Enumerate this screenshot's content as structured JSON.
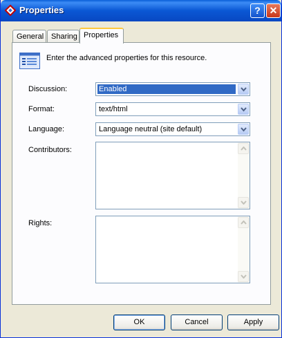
{
  "window": {
    "title": "Properties"
  },
  "title_buttons": {
    "help": "?",
    "close": "✕"
  },
  "tabs": [
    {
      "label": "General"
    },
    {
      "label": "Sharing"
    },
    {
      "label": "Properties"
    }
  ],
  "panel": {
    "header_text": "Enter the advanced properties for this resource.",
    "fields": {
      "discussion": {
        "label": "Discussion:",
        "value": "Enabled"
      },
      "format": {
        "label": "Format:",
        "value": "text/html"
      },
      "language": {
        "label": "Language:",
        "value": "Language neutral (site default)"
      },
      "contributors": {
        "label": "Contributors:",
        "value": ""
      },
      "rights": {
        "label": "Rights:",
        "value": ""
      }
    }
  },
  "buttons": {
    "ok": "OK",
    "cancel": "Cancel",
    "apply": "Apply"
  },
  "colors": {
    "titlebar": "#0a57d4",
    "selection": "#316ac5",
    "active_tab_accent": "#ffc83c",
    "dialog_bg": "#ece9d8"
  },
  "icons": {
    "app": "diamond-icon",
    "header": "properties-form-icon",
    "dropdown": "chevron-down-icon",
    "scroll_up": "scroll-up-icon",
    "scroll_down": "scroll-down-icon"
  }
}
